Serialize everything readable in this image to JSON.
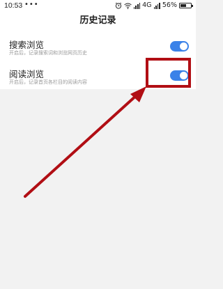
{
  "status_bar": {
    "time": "10:53",
    "dots": "•••",
    "network_label": "4G",
    "battery_text": "56%",
    "battery_level": 0.56,
    "icons": [
      "alarm-icon",
      "wifi-icon",
      "signal-icon",
      "signal-icon",
      "battery-icon"
    ]
  },
  "header": {
    "title": "历史记录"
  },
  "settings": [
    {
      "title": "搜索浏览",
      "description": "开启后，记录搜索词和浏览网页历史",
      "enabled": true
    },
    {
      "title": "阅读浏览",
      "description": "开启后，记录首页各栏目的阅读内容",
      "enabled": true
    }
  ],
  "colors": {
    "toggle_on": "#3b82e8",
    "annotation": "#b10e14",
    "background": "#f2f2f2"
  }
}
